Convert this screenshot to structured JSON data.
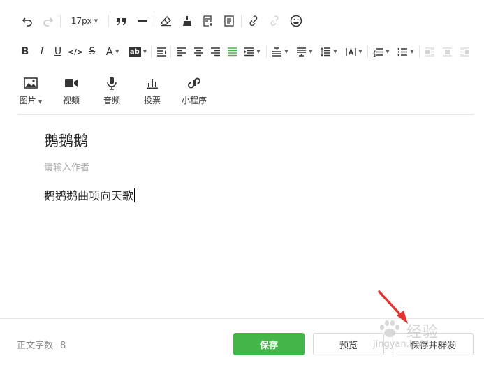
{
  "toolbar": {
    "font_size": "17px",
    "media": [
      {
        "label": "图片",
        "icon": "image-icon"
      },
      {
        "label": "视频",
        "icon": "video-icon"
      },
      {
        "label": "音频",
        "icon": "microphone-icon"
      },
      {
        "label": "投票",
        "icon": "bar-chart-icon"
      },
      {
        "label": "小程序",
        "icon": "mini-program-icon"
      }
    ]
  },
  "article": {
    "title": "鹅鹅鹅",
    "author_placeholder": "请输入作者",
    "body": "鹅鹅鹅曲项向天歌"
  },
  "footer": {
    "word_count_label": "正文字数",
    "word_count": "8",
    "save_label": "保存",
    "preview_label": "预览",
    "save_send_label": "保存并群发"
  },
  "watermark": {
    "text": "经验",
    "url": "jingyan.baidu.com"
  },
  "colors": {
    "primary_green": "#44b549",
    "annotation_arrow": "#e8302f"
  }
}
